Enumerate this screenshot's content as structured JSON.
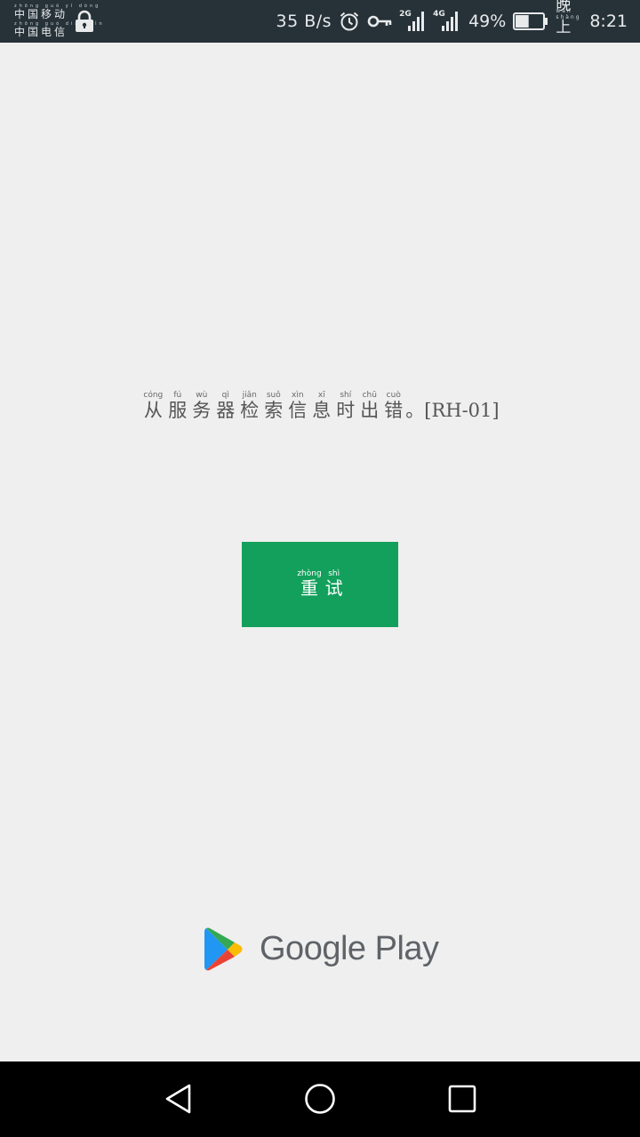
{
  "status_bar": {
    "carriers": [
      {
        "pinyin": "zhōng guó yí dòng",
        "name": "中国移动"
      },
      {
        "pinyin": "zhōng guó diàn xìn",
        "name": "中国电信"
      }
    ],
    "net_speed": "35 B/s",
    "signal_1_label": "2G",
    "signal_2_label": "4G",
    "battery_percent": "49%",
    "battery_level": 0.49,
    "ampm_pinyin": "wǎn shàng",
    "ampm_label": "晚上",
    "time": "8:21"
  },
  "error": {
    "chars": [
      {
        "hz": "从",
        "py": "cóng"
      },
      {
        "hz": "服",
        "py": "fú"
      },
      {
        "hz": "务",
        "py": "wù"
      },
      {
        "hz": "器",
        "py": "qì"
      },
      {
        "hz": "检",
        "py": "jiǎn"
      },
      {
        "hz": "索",
        "py": "suǒ"
      },
      {
        "hz": "信",
        "py": "xìn"
      },
      {
        "hz": "息",
        "py": "xī"
      },
      {
        "hz": "时",
        "py": "shí"
      },
      {
        "hz": "出",
        "py": "chū"
      },
      {
        "hz": "错",
        "py": "cuò"
      }
    ],
    "suffix": "。[RH-01]"
  },
  "retry_button": {
    "chars": [
      {
        "hz": "重",
        "py": "zhòng"
      },
      {
        "hz": "试",
        "py": "shì"
      }
    ]
  },
  "brand": {
    "text": "Google Play"
  },
  "colors": {
    "status_bar_bg": "#263238",
    "page_bg": "#efefef",
    "button_green": "#13a05c",
    "nav_bar_bg": "#000000"
  },
  "icons": {
    "lock": "lock-icon",
    "alarm": "alarm-icon",
    "key": "key-icon",
    "signal": "signal-icon",
    "battery": "battery-icon",
    "play": "google-play-icon",
    "back": "back-icon",
    "home": "home-icon",
    "recents": "recents-icon"
  }
}
